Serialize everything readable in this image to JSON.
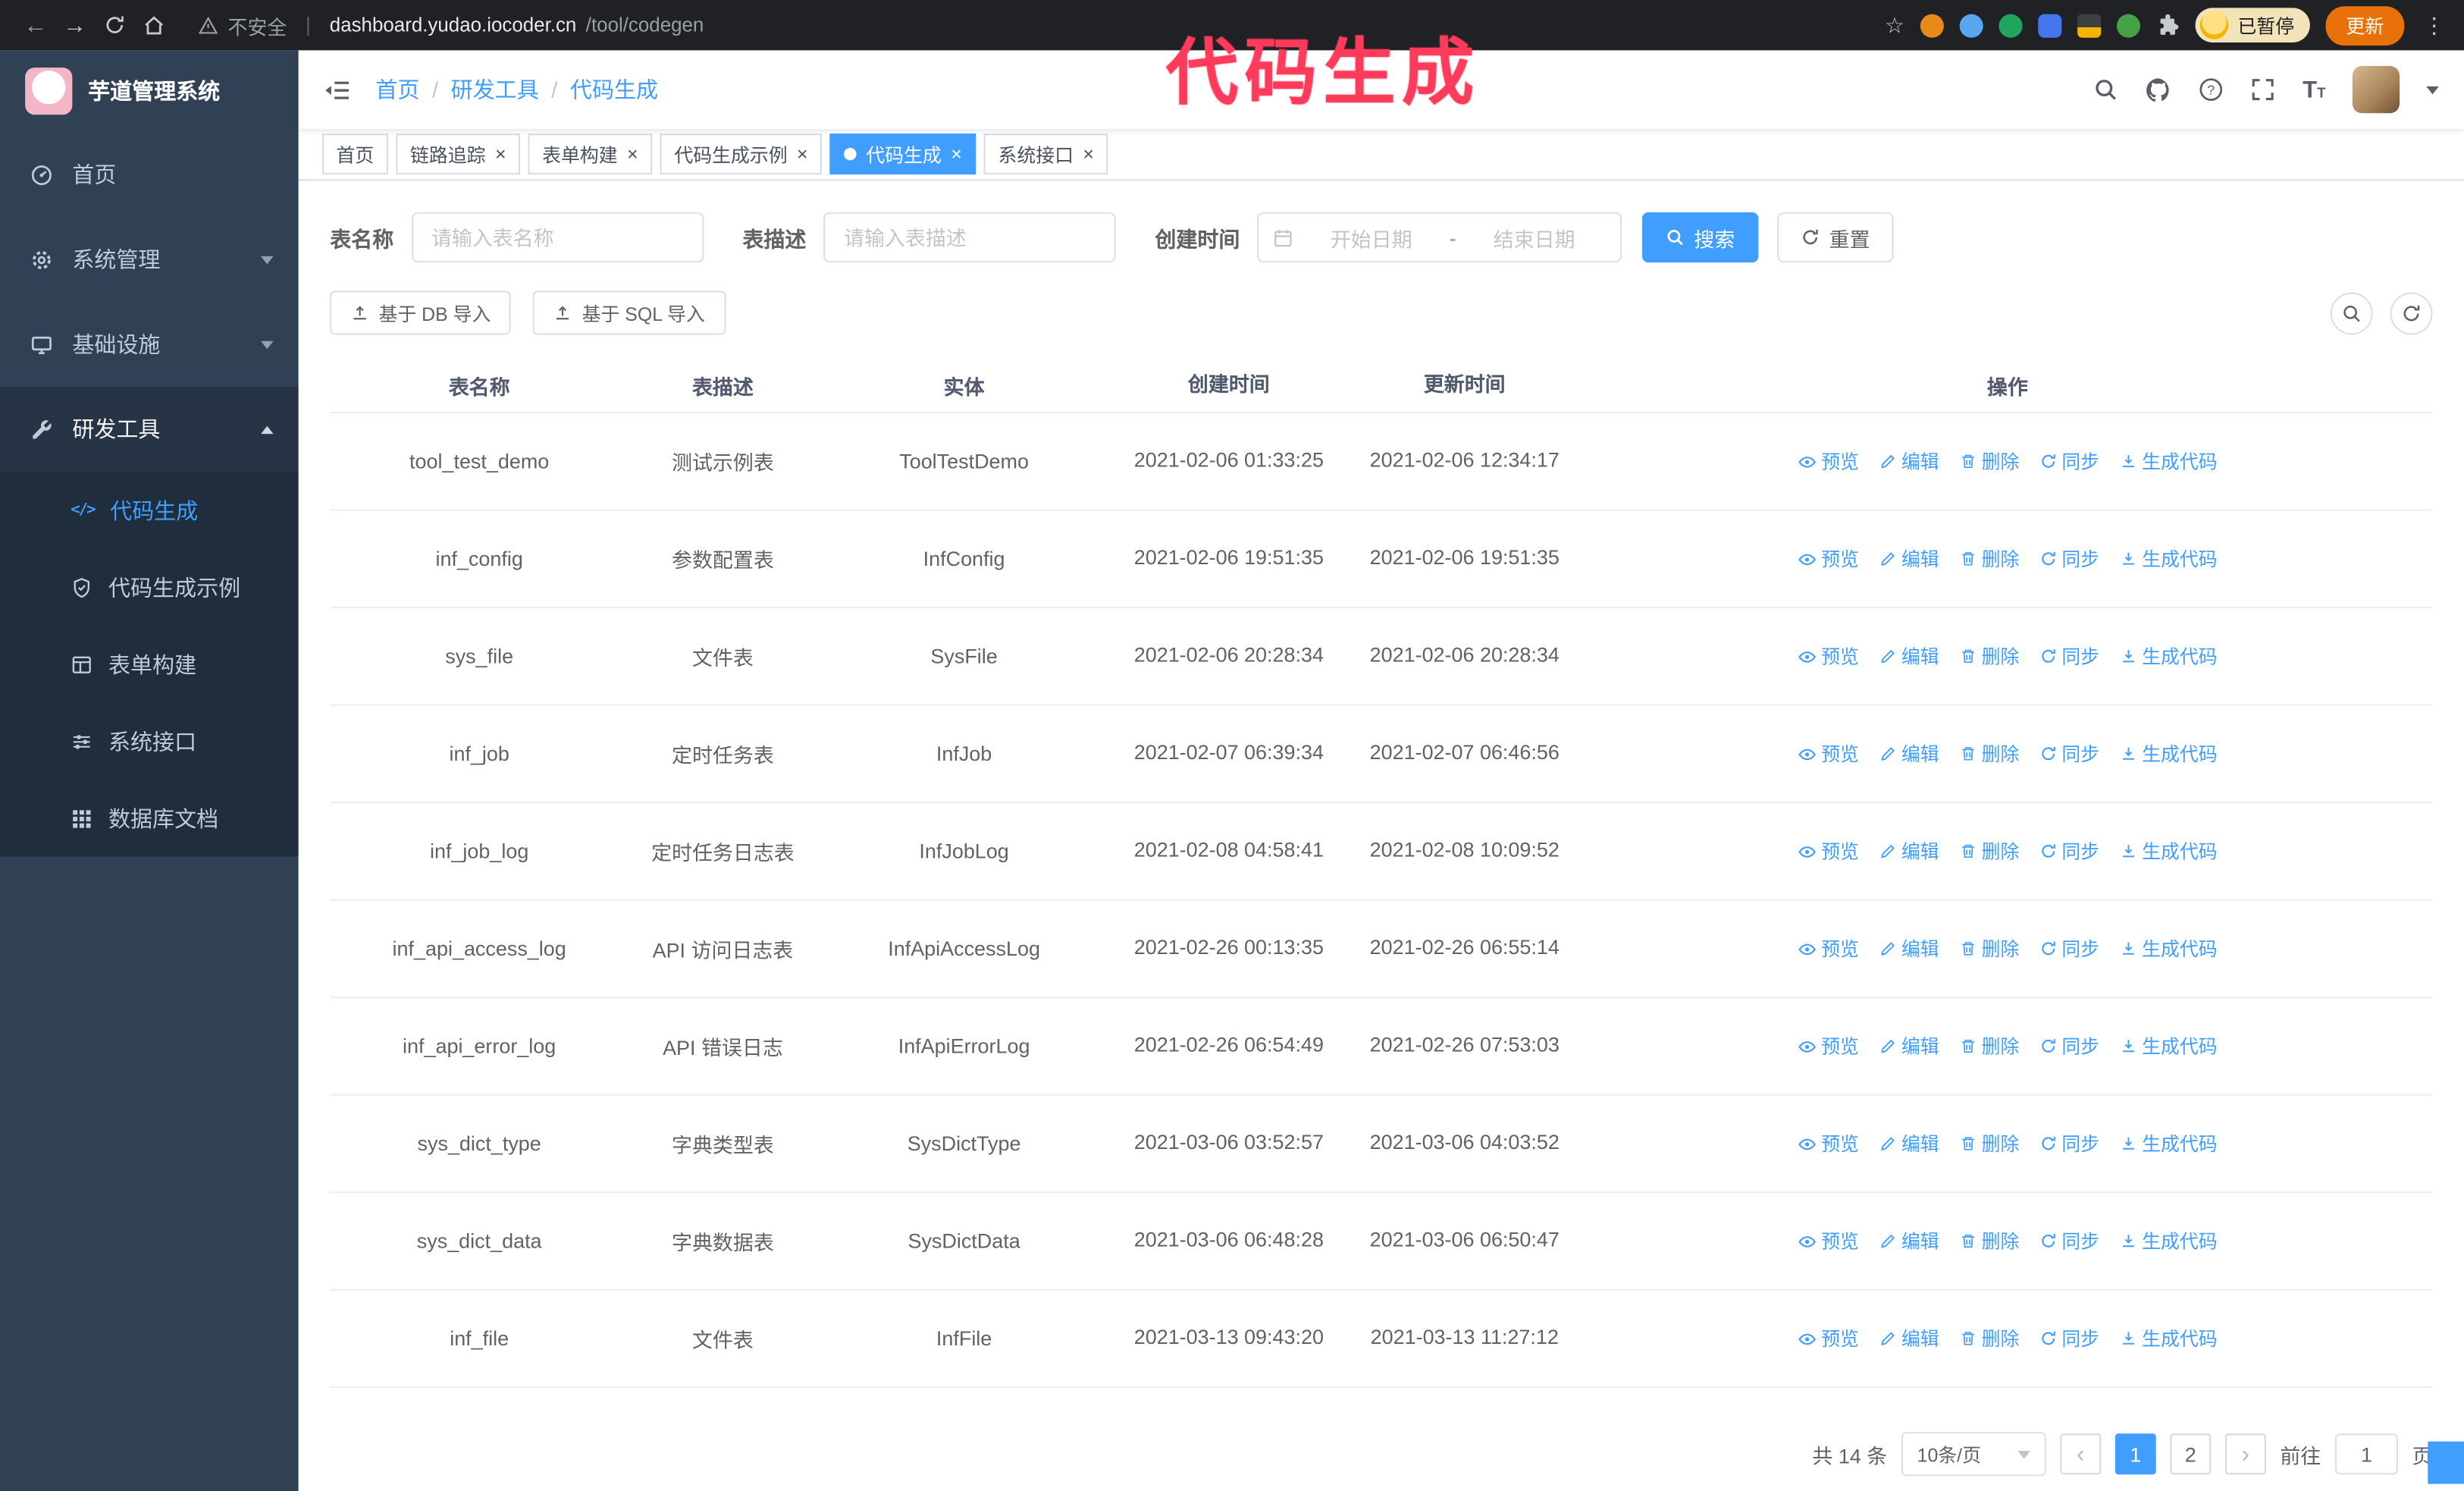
{
  "annotation": {
    "text": "代码生成",
    "color": "#ff3b5c"
  },
  "browser": {
    "security_label": "不安全",
    "url_host": "dashboard.yudao.iocoder.cn",
    "url_path": "/tool/codegen",
    "paused_badge": "已暂停",
    "update_label": "更新"
  },
  "sidebar": {
    "app_title": "芋道管理系统",
    "items": [
      {
        "label": "首页",
        "icon": "dashboard",
        "expanded": false
      },
      {
        "label": "系统管理",
        "icon": "gear",
        "expanded": false
      },
      {
        "label": "基础设施",
        "icon": "monitor",
        "expanded": false
      },
      {
        "label": "研发工具",
        "icon": "wrench",
        "expanded": true
      }
    ],
    "subitems": [
      {
        "label": "代码生成",
        "active": true
      },
      {
        "label": "代码生成示例",
        "active": false
      },
      {
        "label": "表单构建",
        "active": false
      },
      {
        "label": "系统接口",
        "active": false
      },
      {
        "label": "数据库文档",
        "active": false
      }
    ]
  },
  "header": {
    "breadcrumb": [
      "首页",
      "研发工具",
      "代码生成"
    ]
  },
  "tabs": [
    {
      "label": "首页",
      "closable": false,
      "active": false
    },
    {
      "label": "链路追踪",
      "closable": true,
      "active": false
    },
    {
      "label": "表单构建",
      "closable": true,
      "active": false
    },
    {
      "label": "代码生成示例",
      "closable": true,
      "active": false
    },
    {
      "label": "代码生成",
      "closable": true,
      "active": true
    },
    {
      "label": "系统接口",
      "closable": true,
      "active": false
    }
  ],
  "filters": {
    "table_name_label": "表名称",
    "table_name_placeholder": "请输入表名称",
    "table_desc_label": "表描述",
    "table_desc_placeholder": "请输入表描述",
    "create_time_label": "创建时间",
    "date_start_placeholder": "开始日期",
    "date_separator": "-",
    "date_end_placeholder": "结束日期",
    "search_label": "搜索",
    "reset_label": "重置"
  },
  "toolbar": {
    "import_db_label": "基于 DB 导入",
    "import_sql_label": "基于 SQL 导入"
  },
  "table": {
    "columns": [
      "表名称",
      "表描述",
      "实体",
      "创建时间",
      "更新时间",
      "操作"
    ],
    "actions": [
      "预览",
      "编辑",
      "删除",
      "同步",
      "生成代码"
    ],
    "rows": [
      {
        "name": "tool_test_demo",
        "desc": "测试示例表",
        "entity": "ToolTestDemo",
        "created": "2021-02-06 01:33:25",
        "updated": "2021-02-06 12:34:17"
      },
      {
        "name": "inf_config",
        "desc": "参数配置表",
        "entity": "InfConfig",
        "created": "2021-02-06 19:51:35",
        "updated": "2021-02-06 19:51:35"
      },
      {
        "name": "sys_file",
        "desc": "文件表",
        "entity": "SysFile",
        "created": "2021-02-06 20:28:34",
        "updated": "2021-02-06 20:28:34"
      },
      {
        "name": "inf_job",
        "desc": "定时任务表",
        "entity": "InfJob",
        "created": "2021-02-07 06:39:34",
        "updated": "2021-02-07 06:46:56"
      },
      {
        "name": "inf_job_log",
        "desc": "定时任务日志表",
        "entity": "InfJobLog",
        "created": "2021-02-08 04:58:41",
        "updated": "2021-02-08 10:09:52"
      },
      {
        "name": "inf_api_access_log",
        "desc": "API 访问日志表",
        "entity": "InfApiAccessLog",
        "created": "2021-02-26 00:13:35",
        "updated": "2021-02-26 06:55:14"
      },
      {
        "name": "inf_api_error_log",
        "desc": "API 错误日志",
        "entity": "InfApiErrorLog",
        "created": "2021-02-26 06:54:49",
        "updated": "2021-02-26 07:53:03"
      },
      {
        "name": "sys_dict_type",
        "desc": "字典类型表",
        "entity": "SysDictType",
        "created": "2021-03-06 03:52:57",
        "updated": "2021-03-06 04:03:52"
      },
      {
        "name": "sys_dict_data",
        "desc": "字典数据表",
        "entity": "SysDictData",
        "created": "2021-03-06 06:48:28",
        "updated": "2021-03-06 06:50:47"
      },
      {
        "name": "inf_file",
        "desc": "文件表",
        "entity": "InfFile",
        "created": "2021-03-13 09:43:20",
        "updated": "2021-03-13 11:27:12"
      }
    ]
  },
  "pagination": {
    "total_text": "共 14 条",
    "page_size": "10条/页",
    "pages": [
      "1",
      "2"
    ],
    "active_page": "1",
    "goto_label": "前往",
    "goto_value": "1",
    "goto_suffix": "页"
  },
  "colors": {
    "accent": "#409eff",
    "sidebar_bg": "#304156",
    "submenu_bg": "#1f2d3d",
    "chrome_bg": "#202124",
    "annotation": "#ff3b5c",
    "tab_active": "#409eff"
  }
}
